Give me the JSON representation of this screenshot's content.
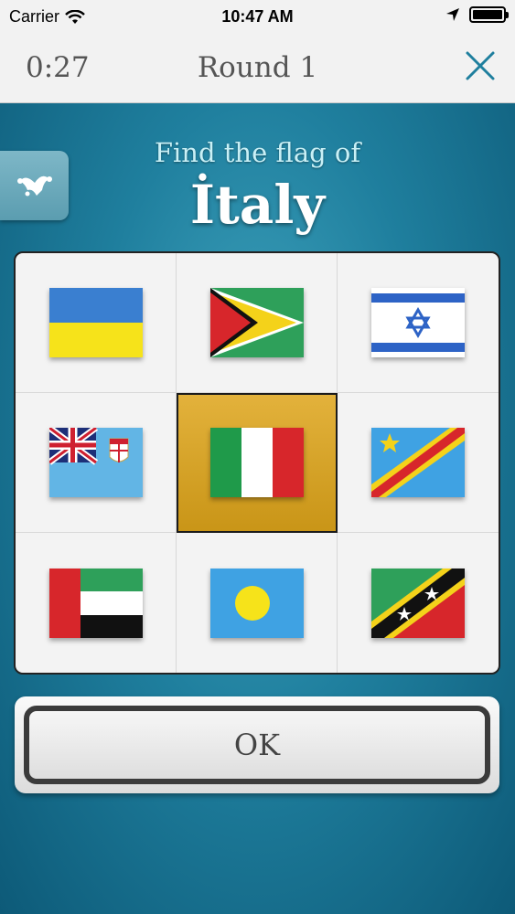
{
  "status": {
    "carrier": "Carrier",
    "time": "10:47 AM"
  },
  "header": {
    "timer": "0:27",
    "round": "Round 1"
  },
  "prompt": {
    "label": "Find the flag of",
    "country": "İtaly"
  },
  "grid": {
    "selected_index": 4,
    "flags": [
      "ukraine-flag",
      "guyana-flag",
      "israel-flag",
      "fiji-flag",
      "italy-flag",
      "dr-congo-flag",
      "uae-flag",
      "palau-flag",
      "saint-kitts-and-nevis-flag"
    ]
  },
  "ok_button": {
    "label": "OK"
  },
  "colors": {
    "accent": "#1f7f9e",
    "selected": "#e3b23c",
    "text_dark": "#555555"
  }
}
